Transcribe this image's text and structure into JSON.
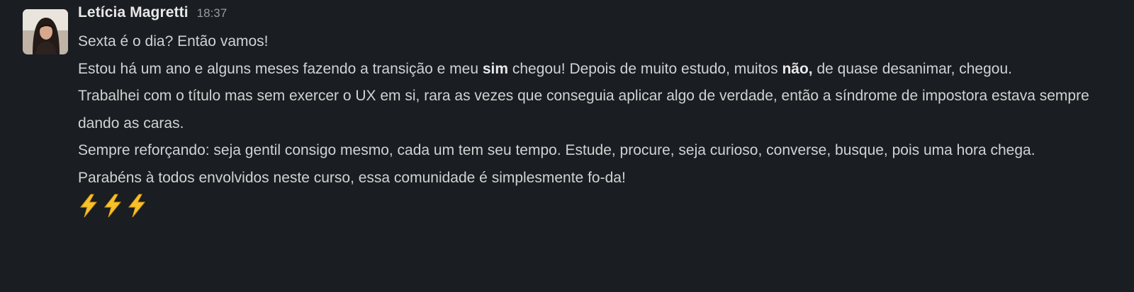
{
  "message": {
    "author": "Letícia Magretti",
    "time": "18:37",
    "lines": [
      {
        "text": "Sexta é o dia? Então vamos!"
      },
      {
        "parts": [
          {
            "t": "Estou há um ano e alguns meses fazendo a transição e meu "
          },
          {
            "t": "sim",
            "bold": true
          },
          {
            "t": " chegou! Depois de muito estudo, muitos "
          },
          {
            "t": "não,",
            "bold": true
          },
          {
            "t": " de quase desanimar, chegou."
          }
        ]
      },
      {
        "text": "Trabalhei com o título mas sem exercer o UX em si, rara as vezes que conseguia aplicar algo de verdade, então a síndrome de impostora estava sempre dando as caras."
      },
      {
        "text": "Sempre reforçando: seja gentil consigo mesmo, cada um tem seu tempo. Estude, procure, seja curioso, converse, busque, pois uma hora chega."
      },
      {
        "text": "Parabéns à todos envolvidos neste curso, essa comunidade é simplesmente fo-da!"
      }
    ],
    "emojis": [
      "zap-emoji",
      "zap-emoji",
      "zap-emoji"
    ],
    "colors": {
      "background": "#1a1d21",
      "text": "#d1d2d3",
      "timestamp": "#9a9b9d",
      "emoji": "#f6c12b"
    }
  }
}
